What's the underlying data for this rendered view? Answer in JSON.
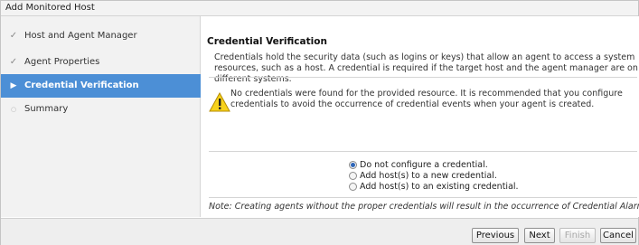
{
  "window": {
    "title": "Add Monitored Host"
  },
  "sidebar": {
    "steps": [
      {
        "label": "Host and Agent Manager",
        "state": "done",
        "icon": "checkmark-icon"
      },
      {
        "label": "Agent Properties",
        "state": "done",
        "icon": "checkmark-icon"
      },
      {
        "label": "Credential Verification",
        "state": "current",
        "icon": "triangle-right-icon"
      },
      {
        "label": "Summary",
        "state": "pending",
        "icon": "circle-icon"
      }
    ]
  },
  "main": {
    "section_title": "Credential Verification",
    "description": "Credentials hold the security data (such as logins or keys) that allow an agent to access a system resources, such as a host. A credential is required if the target host and the agent manager are on different systems.",
    "warning": {
      "icon": "warning-icon",
      "text": "No credentials were found for the provided resource. It is recommended that you configure credentials to avoid the occurrence of credential events when your agent is created."
    },
    "options": [
      {
        "label": "Do not configure a credential.",
        "checked": true
      },
      {
        "label": "Add host(s) to a new credential.",
        "checked": false
      },
      {
        "label": "Add host(s) to an existing credential.",
        "checked": false
      }
    ],
    "note": "Note: Creating agents without the proper credentials will result in the occurrence of Credential Alarms."
  },
  "footer": {
    "previous_label": "Previous",
    "next_label": "Next",
    "finish_label": "Finish",
    "cancel_label": "Cancel"
  },
  "colors": {
    "selected_step": "#4c8fd6",
    "warning_fill": "#f7d21c"
  }
}
